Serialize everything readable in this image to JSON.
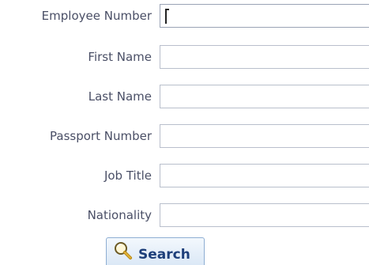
{
  "form": {
    "fields": [
      {
        "label": "Employee Number",
        "value": "",
        "placeholder": ""
      },
      {
        "label": "First Name",
        "value": "",
        "placeholder": ""
      },
      {
        "label": "Last Name",
        "value": "",
        "placeholder": ""
      },
      {
        "label": "Passport Number",
        "value": "",
        "placeholder": ""
      },
      {
        "label": "Job Title",
        "value": "",
        "placeholder": ""
      },
      {
        "label": "Nationality",
        "value": "",
        "placeholder": ""
      }
    ],
    "search_label": "Search",
    "search_icon": "magnifier-icon"
  },
  "colors": {
    "label_text": "#4a4f66",
    "field_border": "#b9bfcc",
    "button_text": "#1d3f7a",
    "button_border": "#8eaed3"
  }
}
